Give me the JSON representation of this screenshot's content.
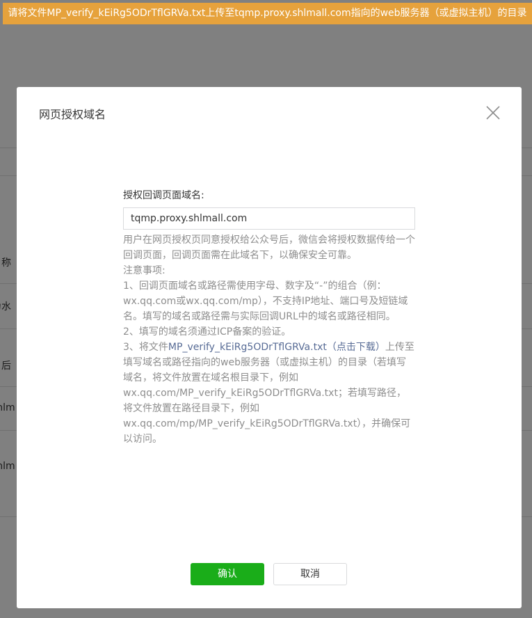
{
  "notice": {
    "text": "请将文件MP_verify_kEiRg5ODrTflGRVa.txt上传至tqmp.proxy.shlmall.com指向的web服务器（或虚拟主机）的目录"
  },
  "background": {
    "labels": [
      "名称",
      "为水",
      "名后",
      "shlm",
      "shlm"
    ]
  },
  "dialog": {
    "title": "网页授权域名",
    "close_icon": "close-icon",
    "field_label": "授权回调页面域名:",
    "domain_value": "tqmp.proxy.shlmall.com",
    "desc": "用户在网页授权页同意授权给公众号后，微信会将授权数据传给一个回调页面，回调页面需在此域名下，以确保安全可靠。",
    "notes_title": "注意事项:",
    "note1": "1、回调页面域名或路径需使用字母、数字及“-”的组合（例：wx.qq.com或wx.qq.com/mp），不支持IP地址、端口号及短链域名。填写的域名或路径需与实际回调URL中的域名或路径相同。",
    "note2": "2、填写的域名须通过ICP备案的验证。",
    "note3_prefix": "3、将文件",
    "note3_link": "MP_verify_kEiRg5ODrTflGRVa.txt（点击下载）",
    "note3_suffix": "上传至填写域名或路径指向的web服务器（或虚拟主机）的目录（若填写域名，将文件放置在域名根目录下，例如wx.qq.com/MP_verify_kEiRg5ODrTflGRVa.txt；若填写路径，将文件放置在路径目录下，例如wx.qq.com/mp/MP_verify_kEiRg5ODrTflGRVa.txt），并确保可以访问。",
    "confirm_label": "确认",
    "cancel_label": "取消"
  },
  "colors": {
    "notice_bg": "#e6a23c",
    "primary": "#1aad19",
    "link": "#576b95"
  }
}
